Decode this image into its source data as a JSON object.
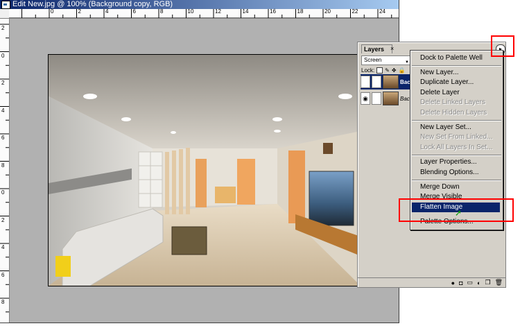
{
  "window": {
    "title": "Edit New.jpg @ 100% (Background copy, RGB)"
  },
  "rulers": {
    "horizontal": [
      "0",
      "2",
      "4",
      "6",
      "8",
      "10",
      "12",
      "14",
      "16",
      "18",
      "20",
      "22",
      "24"
    ],
    "vertical": [
      "2",
      "0",
      "2",
      "4",
      "6",
      "8",
      "0",
      "2",
      "4",
      "6",
      "8"
    ]
  },
  "layers_palette": {
    "tab_label": "Layers",
    "close": "×",
    "menu_button": "▸",
    "blend_mode": "Screen",
    "lock_label": "Lock:",
    "layers": [
      {
        "name": "Bac",
        "selected": true
      },
      {
        "name": "Bac",
        "selected": false
      }
    ],
    "bottom_icons": [
      "new-set-icon",
      "mask-icon",
      "folder-icon",
      "adjustment-icon",
      "new-layer-icon",
      "trash-icon"
    ]
  },
  "context_menu": {
    "items": [
      {
        "label": "Dock to Palette Well",
        "enabled": true,
        "highlighted": false
      },
      {
        "label": "New Layer...",
        "enabled": true,
        "highlighted": false
      },
      {
        "label": "Duplicate Layer...",
        "enabled": true,
        "highlighted": false
      },
      {
        "label": "Delete Layer",
        "enabled": true,
        "highlighted": false
      },
      {
        "label": "Delete Linked Layers",
        "enabled": false,
        "highlighted": false
      },
      {
        "label": "Delete Hidden Layers",
        "enabled": false,
        "highlighted": false
      },
      {
        "label": "New Layer Set...",
        "enabled": true,
        "highlighted": false
      },
      {
        "label": "New Set From Linked...",
        "enabled": false,
        "highlighted": false
      },
      {
        "label": "Lock All Layers In Set...",
        "enabled": false,
        "highlighted": false
      },
      {
        "label": "Layer Properties...",
        "enabled": true,
        "highlighted": false
      },
      {
        "label": "Blending Options...",
        "enabled": true,
        "highlighted": false
      },
      {
        "label": "Merge Down",
        "enabled": true,
        "highlighted": false
      },
      {
        "label": "Merge Visible",
        "enabled": true,
        "highlighted": false
      },
      {
        "label": "Flatten Image",
        "enabled": true,
        "highlighted": true
      },
      {
        "label": "Palette Options...",
        "enabled": true,
        "highlighted": false
      }
    ]
  },
  "colors": {
    "title_bar": "#0a246a",
    "annotation": "#ff0000",
    "canvas_bg": "#b1b1b1",
    "menu_highlight": "#0a246a"
  }
}
